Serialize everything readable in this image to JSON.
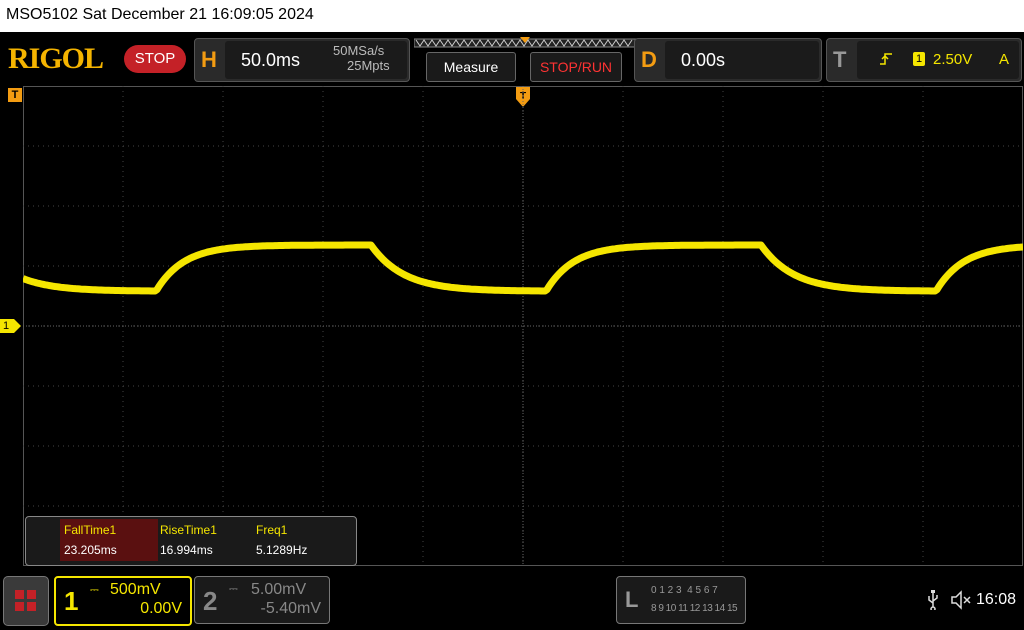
{
  "titlebar": {
    "text": "MSO5102  Sat December 21 16:09:05 2024"
  },
  "header": {
    "logo": "RIGOL",
    "run_state": "STOP",
    "horizontal": {
      "letter": "H",
      "timebase": "50.0ms",
      "sample_rate": "50MSa/s",
      "memory": "25Mpts"
    },
    "measure_button": "Measure",
    "stop_run_button": "STOP/RUN",
    "delay": {
      "letter": "D",
      "value": "0.00s"
    },
    "trigger": {
      "letter": "T",
      "channel": "1",
      "level": "2.50V",
      "mode": "A"
    }
  },
  "markers": {
    "trigger_marker": "T",
    "channel_marker": "1"
  },
  "waveform": {
    "color": "#f5e600",
    "high_level_div": 1.35,
    "low_level_div": 0.58,
    "period_div": 3.9,
    "rise_div": 1.1,
    "fall_div": 1.3
  },
  "measurements": {
    "headers": [
      "FallTime1",
      "RiseTime1",
      "Freq1"
    ],
    "values": [
      "23.205ms",
      "16.994ms",
      "5.1289Hz"
    ]
  },
  "channels": [
    {
      "number": "1",
      "scale": "500mV",
      "offset": "0.00V",
      "color": "#f5e600",
      "active": true
    },
    {
      "number": "2",
      "scale": "5.00mV",
      "offset": "-5.40mV",
      "color": "#888888",
      "active": false
    }
  ],
  "logic": {
    "letter": "L",
    "row1": "0 1 2 3  4 5 6 7",
    "row2": "8 9 10 11 12 13 14 15"
  },
  "status": {
    "time": "16:08",
    "usb_icon": "usb-icon",
    "sound_icon": "mute-icon"
  }
}
